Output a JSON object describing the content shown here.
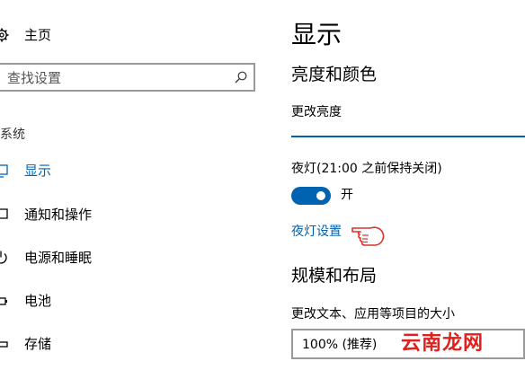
{
  "sidebar": {
    "home_label": "主页",
    "search_placeholder": "查找设置",
    "section_title": "系统",
    "items": [
      {
        "label": "显示",
        "active": true
      },
      {
        "label": "通知和操作"
      },
      {
        "label": "电源和睡眠"
      },
      {
        "label": "电池"
      },
      {
        "label": "存储"
      }
    ]
  },
  "main": {
    "title": "显示",
    "brightness_heading": "亮度和颜色",
    "brightness_label": "更改亮度",
    "nightlight_label": "夜灯(21:00 之前保持关闭)",
    "toggle_label": "开",
    "nightlight_link": "夜灯设置",
    "scale_heading": "规模和布局",
    "scale_label": "更改文本、应用等项目的大小",
    "scale_value": "100% (推荐)"
  },
  "watermark": "云南龙网",
  "colors": {
    "accent": "#0063b1",
    "watermark": "#e0201f"
  }
}
